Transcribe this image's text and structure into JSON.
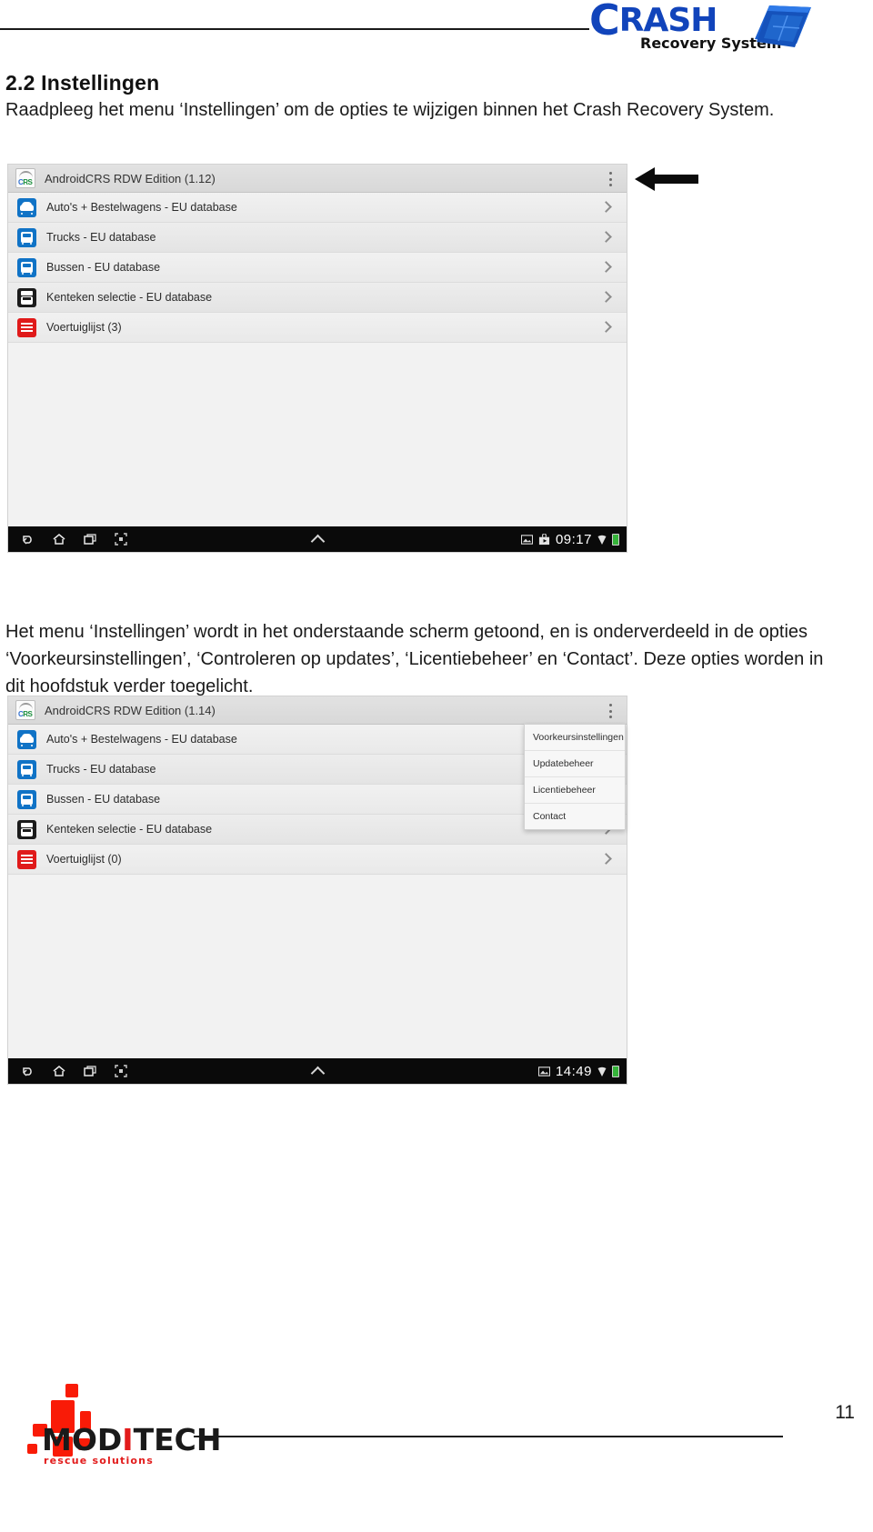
{
  "header": {
    "brand_main_cap": "C",
    "brand_main_rest": "RASH",
    "brand_sub": "Recovery System",
    "logo_icon": "crash-recovery-cube-logo"
  },
  "content": {
    "section_number_title": "2.2 Instellingen",
    "paragraph_1": "Raadpleeg het menu ‘Instellingen’ om de opties te wijzigen binnen het Crash Recovery System.",
    "paragraph_2": "Het menu ‘Instellingen’ wordt in het onderstaande scherm getoond, en is onderverdeeld in de opties ‘Voorkeursinstellingen’, ‘Controleren op updates’, ‘Licentiebeheer’ en ‘Contact’. Deze opties worden in dit hoofdstuk verder toegelicht."
  },
  "screenshot_1": {
    "app_title": "AndroidCRS RDW Edition (1.12)",
    "overflow_menu_icon": "three-dot-overflow-icon",
    "rows": [
      {
        "label": "Auto's + Bestelwagens - EU database",
        "icon": "car-icon"
      },
      {
        "label": "Trucks - EU database",
        "icon": "truck-icon"
      },
      {
        "label": "Bussen - EU database",
        "icon": "bus-icon"
      },
      {
        "label": "Kenteken selectie - EU database",
        "icon": "license-plate-icon"
      },
      {
        "label": "Voertuiglijst (3)",
        "icon": "vehicle-list-icon"
      }
    ],
    "navbar": {
      "back_icon": "back-arrow-icon",
      "home_icon": "home-icon",
      "recents_icon": "recent-apps-icon",
      "screenshot_icon": "screen-capture-icon",
      "expand_icon": "caret-up-icon",
      "image_icon": "image-status-icon",
      "app_icon": "app-status-icon",
      "clock": "09:17",
      "wifi_icon": "wifi-icon",
      "battery_icon": "battery-icon"
    }
  },
  "annotation": {
    "arrow_icon": "left-pointing-arrow-annotation",
    "arrow_color": "#000000"
  },
  "screenshot_2": {
    "app_title": "AndroidCRS RDW Edition (1.14)",
    "overflow_menu_icon": "three-dot-overflow-icon",
    "rows": [
      {
        "label": "Auto's + Bestelwagens - EU database",
        "icon": "car-icon"
      },
      {
        "label": "Trucks - EU database",
        "icon": "truck-icon"
      },
      {
        "label": "Bussen - EU database",
        "icon": "bus-icon"
      },
      {
        "label": "Kenteken selectie - EU database",
        "icon": "license-plate-icon"
      },
      {
        "label": "Voertuiglijst (0)",
        "icon": "vehicle-list-icon"
      }
    ],
    "settings_menu": [
      "Voorkeursinstellingen",
      "Updatebeheer",
      "Licentiebeheer",
      "Contact"
    ],
    "navbar": {
      "back_icon": "back-arrow-icon",
      "home_icon": "home-icon",
      "recents_icon": "recent-apps-icon",
      "screenshot_icon": "screen-capture-icon",
      "expand_icon": "caret-up-icon",
      "image_icon": "image-status-icon",
      "clock": "14:49",
      "wifi_icon": "wifi-icon",
      "battery_icon": "battery-icon"
    }
  },
  "footer": {
    "logo_word_1": "MOD",
    "logo_word_r": "I",
    "logo_word_2": "TECH",
    "logo_tagline": "rescue solutions",
    "logo_icon": "moditech-blocks-logo",
    "page_number": "11"
  },
  "colors": {
    "brand_blue": "#1144bb",
    "row_icon_blue": "#1073c6",
    "row_icon_red": "#e01a1a",
    "moditech_red": "#e21b1b",
    "navbar_black": "#0a0a0a",
    "battery_green": "#36b33a"
  }
}
